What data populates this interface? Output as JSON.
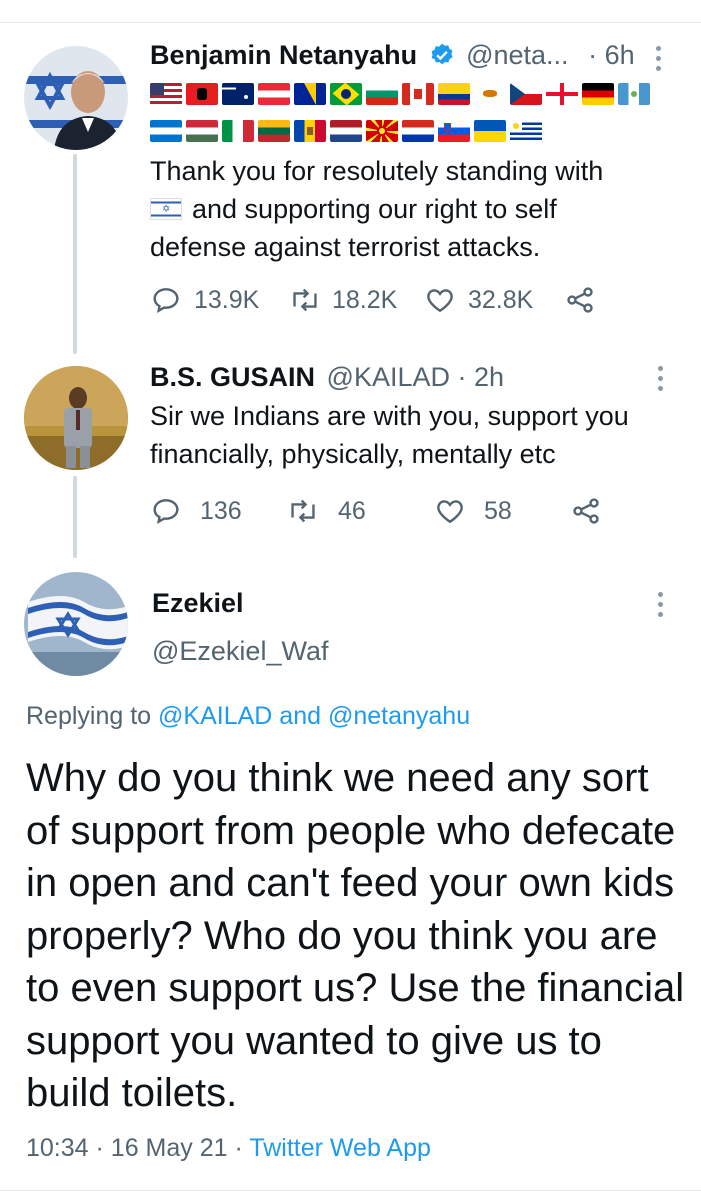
{
  "tweet1": {
    "name": "Benjamin Netanyahu",
    "handle": "@neta...",
    "time": "· 6h",
    "flags_row1": [
      "us",
      "al",
      "au",
      "at",
      "ba",
      "br",
      "bg",
      "ca",
      "co",
      "cy",
      "cz",
      "ge",
      "de",
      "gt"
    ],
    "flags_row2": [
      "hn",
      "hu",
      "it",
      "lt",
      "md",
      "nl",
      "mk",
      "py",
      "si",
      "ua",
      "uy"
    ],
    "text_line1": "Thank you for resolutely standing with",
    "text_line2": "and supporting our right to self",
    "text_line3": "defense against terrorist attacks.",
    "replies": "13.9K",
    "retweets": "18.2K",
    "likes": "32.8K"
  },
  "tweet2": {
    "name": "B.S. GUSAIN",
    "handle": "@KAILAD",
    "time": "· 2h",
    "text_line1": "Sir we Indians are with you, support you",
    "text_line2": "financially, physically, mentally etc",
    "replies": "136",
    "retweets": "46",
    "likes": "58"
  },
  "tweet3": {
    "name": "Ezekiel",
    "handle": "@Ezekiel_Waf",
    "replying_prefix": "Replying to",
    "replying_user1": "@KAILAD",
    "replying_and": "and",
    "replying_user2": "@netanyahu",
    "text": "Why do you think we need any sort of support from people who defecate in open and can't feed your own kids properly? Who do you think you are to even support us? Use the financial support you wanted to give us to build toilets.",
    "time": "10:34",
    "sep1": "·",
    "date": "16 May 21",
    "sep2": "·",
    "source": "Twitter Web App"
  },
  "colors": {
    "accent": "#1d9bf0",
    "secondary_text": "#536471",
    "verified": "#1d9bf0",
    "thread_line": "#cfd9de"
  }
}
